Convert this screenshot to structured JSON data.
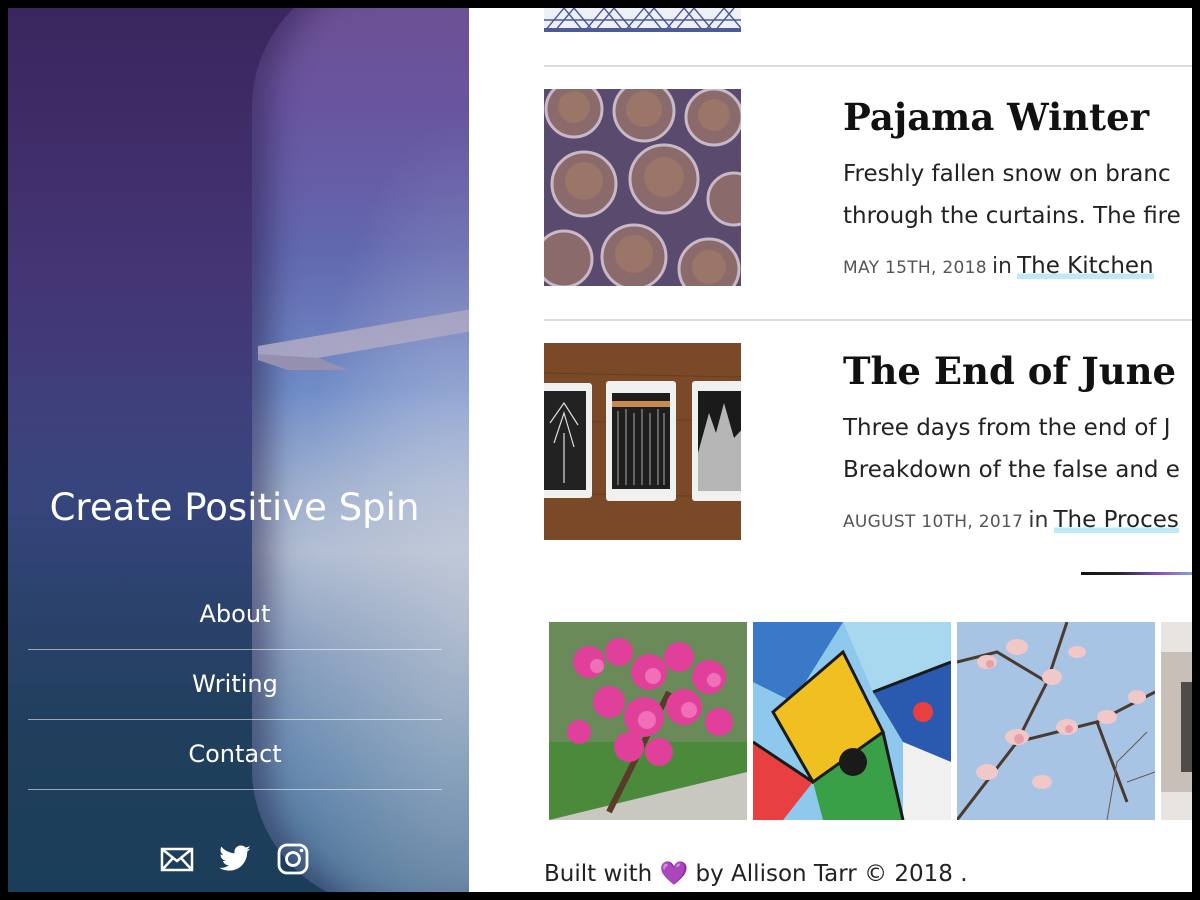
{
  "site": {
    "title": "Create Positive Spin"
  },
  "nav": {
    "items": [
      {
        "label": "About"
      },
      {
        "label": "Writing"
      },
      {
        "label": "Contact"
      }
    ]
  },
  "social": [
    {
      "icon": "mail-icon"
    },
    {
      "icon": "twitter-icon"
    },
    {
      "icon": "instagram-icon"
    }
  ],
  "posts": [
    {
      "title": "Pajama Winter",
      "excerpt_line1": "Freshly fallen snow on branc",
      "excerpt_line2": "through the curtains. The fire",
      "date": "May 15th, 2018",
      "in": "in",
      "category": "The Kitchen",
      "thumb": "muffins"
    },
    {
      "title": "The End of June",
      "excerpt_line1": "Three days from the end of J",
      "excerpt_line2": "Breakdown of the false and e",
      "date": "August 10th, 2017",
      "in": "in",
      "category": "The Proces",
      "thumb": "tarot-cards"
    }
  ],
  "gallery": [
    {
      "image": "pink-blossoms"
    },
    {
      "image": "abstract-painting"
    },
    {
      "image": "magnolia-tree"
    },
    {
      "image": "partial-photo"
    }
  ],
  "footer": {
    "built_with": "Built with",
    "heart": "💜",
    "by": "by Allison Tarr",
    "copyright": "© 2018 ."
  },
  "colors": {
    "accent_purple": "#9b59d0",
    "highlight_blue": "#bfe9f7",
    "text": "#222222"
  }
}
